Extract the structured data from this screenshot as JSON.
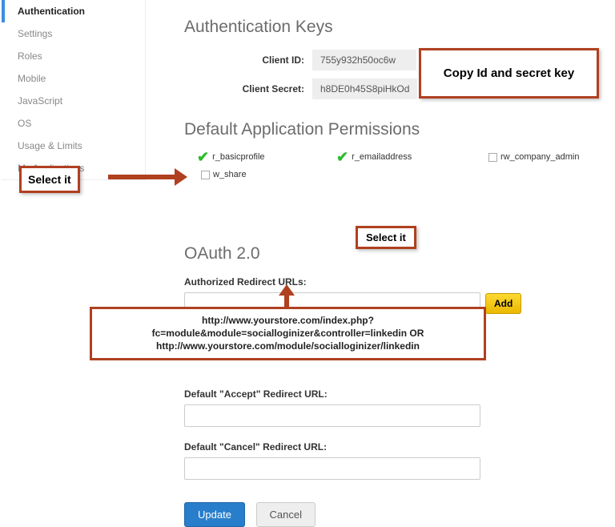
{
  "sidebar": {
    "items": [
      {
        "label": "Authentication",
        "active": true
      },
      {
        "label": "Settings"
      },
      {
        "label": "Roles"
      },
      {
        "label": "Mobile"
      },
      {
        "label": "JavaScript"
      },
      {
        "label": "OS"
      },
      {
        "label": "Usage & Limits"
      },
      {
        "label": "My Applications"
      }
    ]
  },
  "auth_keys": {
    "heading": "Authentication Keys",
    "client_id_label": "Client ID:",
    "client_id_value": "755y932h50oc6w",
    "client_secret_label": "Client Secret:",
    "client_secret_value": "h8DE0h45S8piHkOd"
  },
  "perms": {
    "heading": "Default Application Permissions",
    "r_basicprofile": "r_basicprofile",
    "r_emailaddress": "r_emailaddress",
    "rw_company_admin": "rw_company_admin",
    "w_share": "w_share"
  },
  "oauth": {
    "heading": "OAuth 2.0",
    "auth_redirect_label": "Authorized Redirect URLs:",
    "add_label": "Add",
    "accept_label": "Default \"Accept\" Redirect URL:",
    "cancel_label": "Default \"Cancel\" Redirect URL:",
    "update_btn": "Update",
    "cancel_btn": "Cancel"
  },
  "annotations": {
    "select_it": "Select it",
    "copy_keys": "Copy Id and secret key",
    "hint_line1": "http://www.yourstore.com/index.php?",
    "hint_line2": "fc=module&module=socialloginizer&controller=linkedin OR",
    "hint_line3": "http://www.yourstore.com/module/socialloginizer/linkedin"
  }
}
